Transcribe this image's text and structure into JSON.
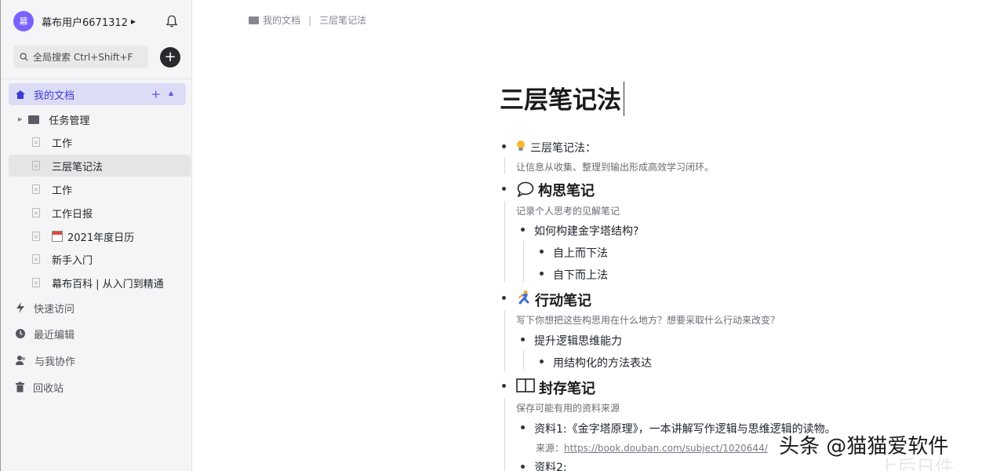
{
  "sidebar": {
    "avatar_text": "幕",
    "username": "幕布用户6671312",
    "search_placeholder": "全局搜索 Ctrl+Shift+F",
    "my_docs_label": "我的文档",
    "tree": [
      {
        "label": "任务管理",
        "type": "folder"
      },
      {
        "label": "工作",
        "type": "doc"
      },
      {
        "label": "三层笔记法",
        "type": "doc",
        "active": true
      },
      {
        "label": "工作",
        "type": "doc"
      },
      {
        "label": "工作日报",
        "type": "doc"
      },
      {
        "label": "2021年度日历",
        "type": "doc"
      },
      {
        "label": "新手入门",
        "type": "doc"
      },
      {
        "label": "幕布百科 | 从入门到精通",
        "type": "doc"
      }
    ],
    "nav": [
      {
        "label": "快速访问",
        "icon": "lightning-icon"
      },
      {
        "label": "最近编辑",
        "icon": "clock-icon"
      },
      {
        "label": "与我协作",
        "icon": "users-icon"
      },
      {
        "label": "回收站",
        "icon": "trash-icon"
      }
    ]
  },
  "breadcrumb": {
    "root": "我的文档",
    "separator": "|",
    "current": "三层笔记法"
  },
  "document": {
    "title": "三层笔记法",
    "intro_title": "三层笔记法：",
    "intro_note": "让信息从收集、整理到输出形成高效学习闭环。",
    "sec1_title": "构思笔记",
    "sec1_note": "记录个人思考的见解笔记",
    "sec1_item": "如何构建金字塔结构?",
    "sec1_sub1": "自上而下法",
    "sec1_sub2": "自下而上法",
    "sec2_title": "行动笔记",
    "sec2_note": "写下你想把这些构思用在什么地方？想要采取什么行动来改变？",
    "sec2_item": "提升逻辑思维能力",
    "sec2_sub1": "用结构化的方法表达",
    "sec3_title": "封存笔记",
    "sec3_note": "保存可能有用的资料来源",
    "sec3_item1": "资料1:《金字塔原理》，一本讲解写作逻辑与思维逻辑的读物。",
    "sec3_source_label": "来源：",
    "sec3_source_url": "https://book.douban.com/subject/1020644/",
    "sec3_item2": "资料2:"
  },
  "watermark": {
    "text": "头条 @猫猫爱软件",
    "text2": "上后日件"
  },
  "colors": {
    "accent": "#3b3bd4",
    "avatar": "#7b61ff",
    "sidebar_bg": "#f5f5f7"
  }
}
